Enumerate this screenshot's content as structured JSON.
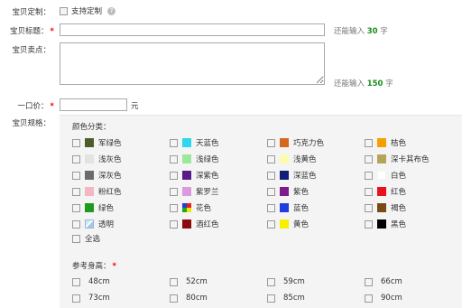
{
  "custom": {
    "label": "宝贝定制：",
    "checkbox_label": "支持定制"
  },
  "title_field": {
    "label": "宝贝标题：",
    "required": "*",
    "value": "",
    "hint_prefix": "还能输入 ",
    "hint_count": "30",
    "hint_suffix": " 字"
  },
  "selling_points": {
    "label": "宝贝卖点：",
    "value": "",
    "hint_prefix": "还能输入 ",
    "hint_count": "150",
    "hint_suffix": " 字"
  },
  "price": {
    "label": "一口价：",
    "required": "*",
    "value": "",
    "unit": "元"
  },
  "spec": {
    "label": "宝贝规格：",
    "color_section_title": "颜色分类：",
    "colors": [
      {
        "name": "军绿色",
        "swatch": "#4b5e2a"
      },
      {
        "name": "天蓝色",
        "swatch": "#2fd6ef"
      },
      {
        "name": "巧克力色",
        "swatch": "#d2691e"
      },
      {
        "name": "桔色",
        "swatch": "#f5a000"
      },
      {
        "name": "浅灰色",
        "swatch": "#e3e3e3"
      },
      {
        "name": "浅绿色",
        "swatch": "#9be89b"
      },
      {
        "name": "浅黄色",
        "swatch": "#fdfbb0"
      },
      {
        "name": "深卡其布色",
        "swatch": "#b5a35c"
      },
      {
        "name": "深灰色",
        "swatch": "#6b6b6b"
      },
      {
        "name": "深紫色",
        "swatch": "#5a1a8a"
      },
      {
        "name": "深蓝色",
        "swatch": "#101e7a"
      },
      {
        "name": "白色",
        "swatch": "#ffffff"
      },
      {
        "name": "粉红色",
        "swatch": "#f4b6c2"
      },
      {
        "name": "紫罗兰",
        "swatch": "#dd99dd"
      },
      {
        "name": "紫色",
        "swatch": "#7d1d8c"
      },
      {
        "name": "红色",
        "swatch": "#e8121e"
      },
      {
        "name": "绿色",
        "swatch": "#1e9a1e"
      },
      {
        "name": "花色",
        "swatch": "multicolor"
      },
      {
        "name": "蓝色",
        "swatch": "#1f3fdc"
      },
      {
        "name": "褐色",
        "swatch": "#7a4a14"
      },
      {
        "name": "透明",
        "swatch": "transparent-pattern"
      },
      {
        "name": "酒红色",
        "swatch": "#8b0a0a"
      },
      {
        "name": "黄色",
        "swatch": "#f8f000"
      },
      {
        "name": "黑色",
        "swatch": "#000000"
      }
    ],
    "select_all_label": "全选",
    "height_section_title": "参考身高：",
    "height_required": "*",
    "heights": [
      "48cm",
      "52cm",
      "59cm",
      "66cm",
      "73cm",
      "80cm",
      "85cm",
      "90cm"
    ]
  }
}
